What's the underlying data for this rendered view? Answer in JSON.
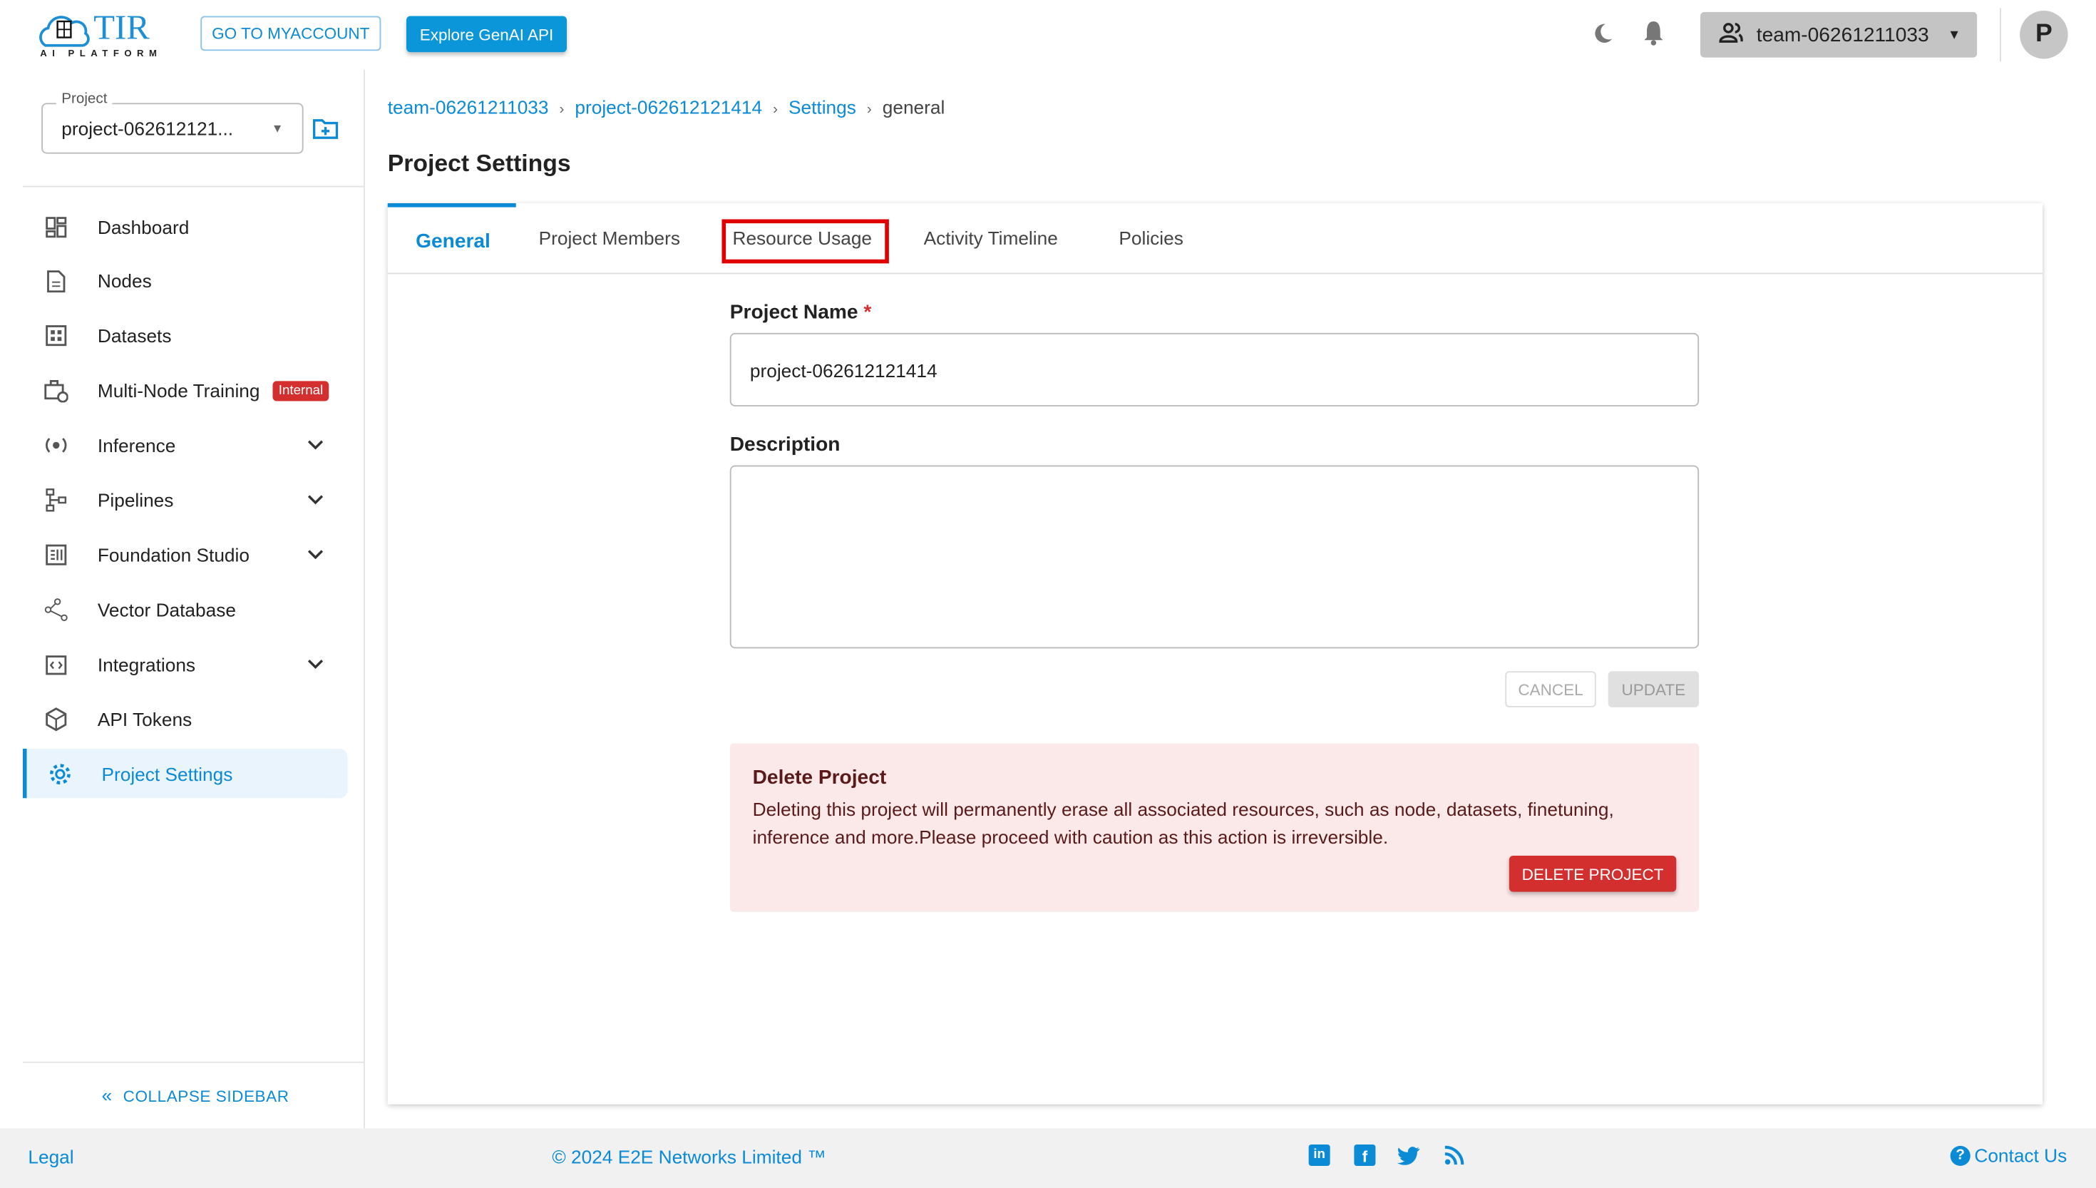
{
  "header": {
    "logo_text": "TIR",
    "logo_sub": "AI PLATFORM",
    "myaccount_label": "GO TO MYACCOUNT",
    "genai_label": "Explore GenAI API",
    "team": "team-06261211033",
    "avatar_initial": "P"
  },
  "sidebar": {
    "project_label": "Project",
    "project_value": "project-062612121...",
    "items": [
      {
        "label": "Dashboard",
        "icon": "dashboard-icon"
      },
      {
        "label": "Nodes",
        "icon": "file-icon"
      },
      {
        "label": "Datasets",
        "icon": "grid-icon"
      },
      {
        "label": "Multi-Node Training",
        "icon": "briefcase-clock-icon",
        "badge": "Internal"
      },
      {
        "label": "Inference",
        "icon": "inference-icon",
        "expandable": true
      },
      {
        "label": "Pipelines",
        "icon": "pipeline-icon",
        "expandable": true
      },
      {
        "label": "Foundation Studio",
        "icon": "studio-icon",
        "expandable": true
      },
      {
        "label": "Vector Database",
        "icon": "vector-icon"
      },
      {
        "label": "Integrations",
        "icon": "integration-icon",
        "expandable": true
      },
      {
        "label": "API Tokens",
        "icon": "token-icon"
      },
      {
        "label": "Project Settings",
        "icon": "gear-icon",
        "active": true
      }
    ],
    "collapse_label": "COLLAPSE SIDEBAR"
  },
  "breadcrumb": [
    "team-06261211033",
    "project-062612121414",
    "Settings",
    "general"
  ],
  "page_title": "Project Settings",
  "tabs": [
    "General",
    "Project Members",
    "Resource Usage",
    "Activity Timeline",
    "Policies"
  ],
  "form": {
    "name_label": "Project Name",
    "required_mark": "*",
    "name_value": "project-062612121414",
    "desc_label": "Description",
    "desc_value": "",
    "cancel": "CANCEL",
    "update": "UPDATE"
  },
  "danger": {
    "title": "Delete Project",
    "text": "Deleting this project will permanently erase all associated resources, such as node, datasets, finetuning, inference and more.Please proceed with caution as this action is irreversible.",
    "button": "DELETE PROJECT"
  },
  "footer": {
    "legal": "Legal",
    "copyright": "© 2024 E2E Networks Limited ™",
    "contact": "Contact Us"
  },
  "colors": {
    "accent": "#0b8ad6",
    "danger": "#d32f2f",
    "highlight_box": "#e00000"
  }
}
